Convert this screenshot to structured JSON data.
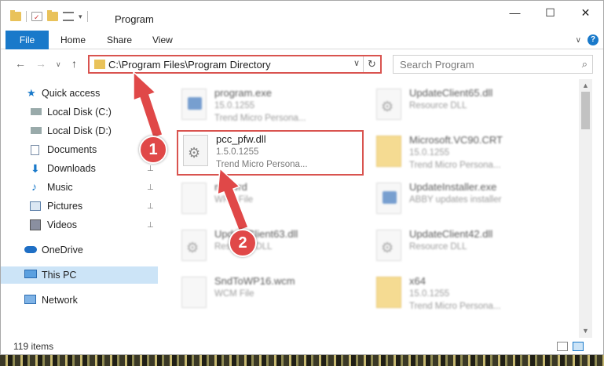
{
  "window": {
    "title": "Program",
    "controls": {
      "minimize": "—",
      "maximize": "☐",
      "close": "✕"
    }
  },
  "ribbon": {
    "tabs": [
      {
        "label": "File"
      },
      {
        "label": "Home"
      },
      {
        "label": "Share"
      },
      {
        "label": "View"
      }
    ],
    "help": "?"
  },
  "nav": {
    "back": "←",
    "forward": "→",
    "recent": "∨",
    "up": "↑",
    "address": "C:\\Program Files\\Program Directory",
    "address_dropdown": "∨",
    "refresh": "↻",
    "search_placeholder": "Search Program",
    "search_icon": "⌕"
  },
  "sidebar": {
    "items": [
      {
        "label": "Quick access",
        "icon": "star-icon",
        "pinned": false
      },
      {
        "label": "Local Disk (C:)",
        "icon": "drive-icon",
        "pinned": true
      },
      {
        "label": "Local Disk (D:)",
        "icon": "drive-icon",
        "pinned": false
      },
      {
        "label": "Documents",
        "icon": "documents-icon",
        "pinned": true
      },
      {
        "label": "Downloads",
        "icon": "downloads-icon",
        "pinned": true
      },
      {
        "label": "Music",
        "icon": "music-icon",
        "pinned": true
      },
      {
        "label": "Pictures",
        "icon": "pictures-icon",
        "pinned": true
      },
      {
        "label": "Videos",
        "icon": "videos-icon",
        "pinned": true
      },
      {
        "label": "OneDrive",
        "icon": "onedrive-icon",
        "pinned": false
      },
      {
        "label": "This PC",
        "icon": "pc-icon",
        "pinned": false,
        "selected": true
      },
      {
        "label": "Network",
        "icon": "network-icon",
        "pinned": false
      }
    ],
    "pin_glyph": "📌"
  },
  "files": [
    {
      "name": "program.exe",
      "line1": "15.0.1255",
      "line2": "Trend Micro Persona...",
      "icon": "exe-icon",
      "highlighted": false
    },
    {
      "name": "UpdateClient65.dll",
      "line1": "Resource DLL",
      "line2": "",
      "icon": "dll-icon",
      "highlighted": false
    },
    {
      "name": "pcc_pfw.dll",
      "line1": "1.5.0.1255",
      "line2": "Trend Micro Persona...",
      "icon": "dll-icon",
      "highlighted": true
    },
    {
      "name": "Microsoft.VC90.CRT",
      "line1": "15.0.1255",
      "line2": "Trend Micro Persona...",
      "icon": "folder-icon",
      "highlighted": false
    },
    {
      "name": "mc.wrd",
      "line1": "WRD File",
      "line2": "",
      "icon": "file-icon",
      "highlighted": false
    },
    {
      "name": "UpdateInstaller.exe",
      "line1": "ABBY updates installer",
      "line2": "",
      "icon": "app-icon",
      "highlighted": false
    },
    {
      "name": "UpdateClient63.dll",
      "line1": "Resource DLL",
      "line2": "",
      "icon": "dll-icon",
      "highlighted": false
    },
    {
      "name": "UpdateClient42.dll",
      "line1": "Resource DLL",
      "line2": "",
      "icon": "dll-icon",
      "highlighted": false
    },
    {
      "name": "SndToWP16.wcm",
      "line1": "WCM File",
      "line2": "",
      "icon": "file-icon",
      "highlighted": false
    },
    {
      "name": "x64",
      "line1": "15.0.1255",
      "line2": "Trend Micro Persona...",
      "icon": "folder-icon",
      "highlighted": false
    }
  ],
  "status": {
    "items_count": "119 items"
  },
  "annotations": {
    "step1": "1",
    "step2": "2"
  },
  "colors": {
    "accent": "#1979ca",
    "highlight": "#d9534f",
    "badge": "#e04848",
    "selected": "#cce4f7"
  }
}
